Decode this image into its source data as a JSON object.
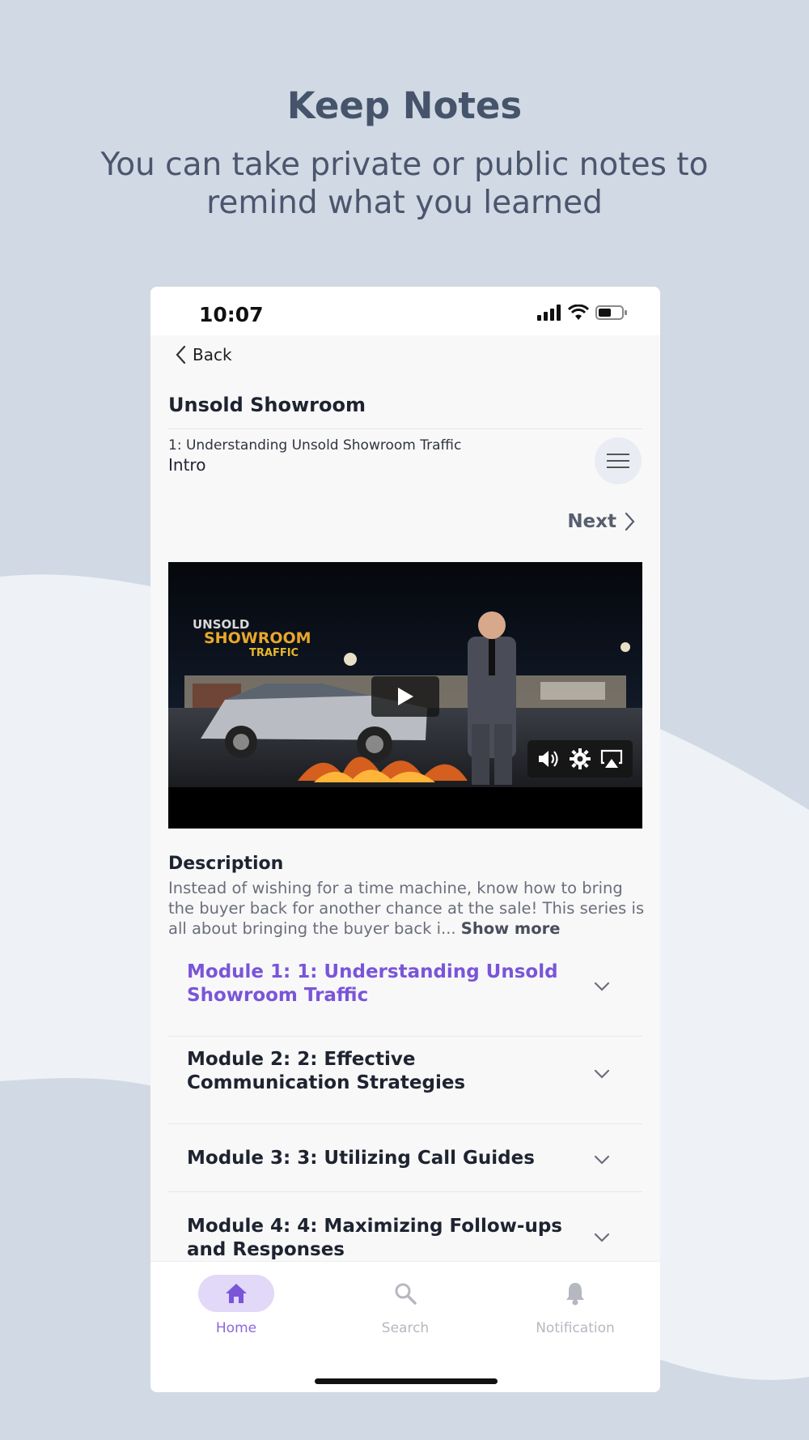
{
  "hero": {
    "title": "Keep Notes",
    "subtitle": "You can take private or public notes to remind what you learned"
  },
  "status_bar": {
    "time": "10:07",
    "icons": [
      "signal-icon",
      "wifi-icon",
      "battery-icon"
    ]
  },
  "nav": {
    "back_label": "Back"
  },
  "course": {
    "title": "Unsold Showroom",
    "lesson_module": "1: Understanding Unsold Showroom Traffic",
    "lesson_name": "Intro",
    "next_label": "Next"
  },
  "video": {
    "controls": [
      "play-icon",
      "volume-icon",
      "settings-icon",
      "airplay-icon"
    ]
  },
  "description": {
    "heading": "Description",
    "text": "Instead of wishing for a time machine, know how to bring the buyer back for another chance at the sale! This series is all about bringing the buyer back i... ",
    "show_more": "Show more"
  },
  "modules": [
    {
      "title": "Module 1: 1: Understanding Unsold Showroom Traffic",
      "active": true
    },
    {
      "title": "Module 2: 2: Effective Communication Strategies",
      "active": false
    },
    {
      "title": "Module 3: 3: Utilizing Call Guides",
      "active": false
    },
    {
      "title": "Module 4: 4: Maximizing Follow-ups and Responses",
      "active": false
    }
  ],
  "tabs": [
    {
      "label": "Home",
      "icon": "home-icon",
      "active": true
    },
    {
      "label": "Search",
      "icon": "search-icon",
      "active": false
    },
    {
      "label": "Notification",
      "icon": "bell-icon",
      "active": false
    }
  ],
  "colors": {
    "accent": "#7a55d8",
    "background": "#d0d9e4",
    "heading": "#46546b"
  }
}
